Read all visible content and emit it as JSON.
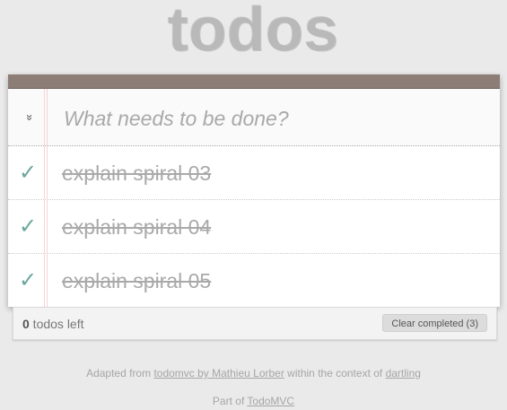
{
  "header": {
    "title": "todos"
  },
  "new_todo": {
    "placeholder": "What needs to be done?",
    "value": ""
  },
  "toggle_all": {
    "icon": "double-chevron-down-icon",
    "glyph": "»"
  },
  "todos": [
    {
      "label": "explain spiral 03",
      "completed": true
    },
    {
      "label": "explain spiral 04",
      "completed": true
    },
    {
      "label": "explain spiral 05",
      "completed": true
    }
  ],
  "check_glyph": "✓",
  "footer": {
    "count": "0",
    "count_suffix": " todos left",
    "clear_label": "Clear completed (3)"
  },
  "info": {
    "line1_prefix": "Adapted from ",
    "line1_link1": "todomvc by Mathieu Lorber",
    "line1_middle": " within the context of ",
    "line1_link2": "dartling",
    "line2_prefix": "Part of ",
    "line2_link": "TodoMVC"
  },
  "colors": {
    "accent_bar": "#8d7d77",
    "check": "#6aa79c",
    "background": "#eaeaea"
  }
}
